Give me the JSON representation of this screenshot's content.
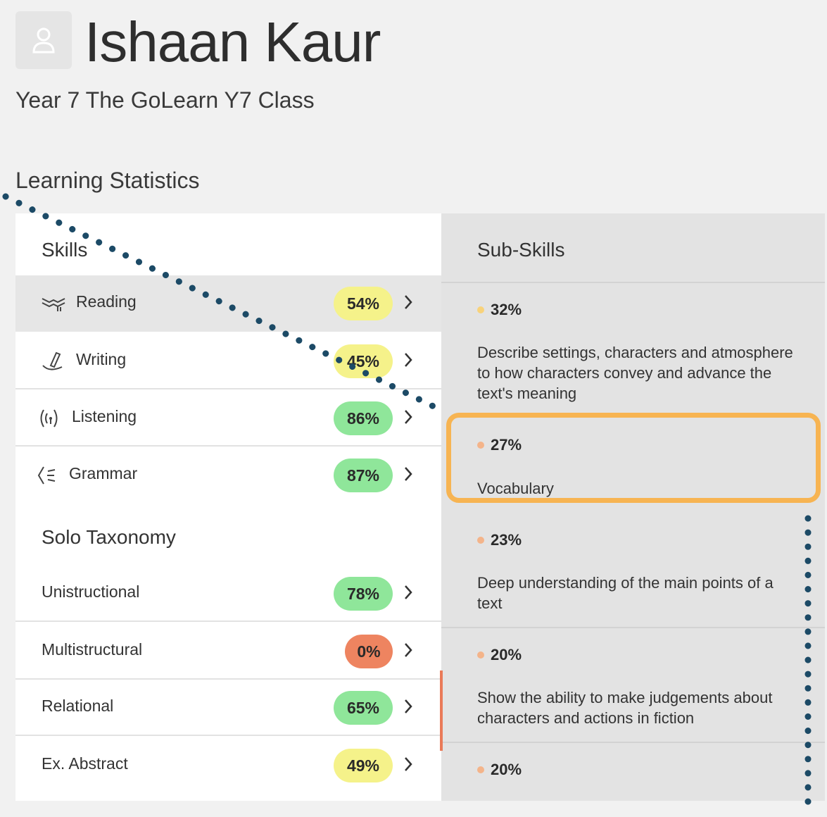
{
  "colors": {
    "badge_yellow": "#f5f28a",
    "badge_green": "#8fe69a",
    "badge_red": "#ee8460",
    "dot_yellow": "#f8d27a",
    "dot_orange": "#f4b48a",
    "highlight": "#f7b452",
    "annotation_dotted": "#1c4a66"
  },
  "student": {
    "avatar_icon": "user-icon",
    "name": "Ishaan Kaur",
    "class": "Year 7 The GoLearn Y7 Class"
  },
  "section_title": "Learning Statistics",
  "skills": {
    "heading": "Skills",
    "items": [
      {
        "label": "Reading",
        "percent": "54%",
        "icon": "reading-icon",
        "color": "yellow"
      },
      {
        "label": "Writing",
        "percent": "45%",
        "icon": "writing-icon",
        "color": "yellow"
      },
      {
        "label": "Listening",
        "percent": "86%",
        "icon": "listening-icon",
        "color": "green"
      },
      {
        "label": "Grammar",
        "percent": "87%",
        "icon": "grammar-icon",
        "color": "green"
      }
    ]
  },
  "solo": {
    "heading": "Solo Taxonomy",
    "items": [
      {
        "label": "Unistructional",
        "percent": "78%",
        "color": "green"
      },
      {
        "label": "Multistructural",
        "percent": "0%",
        "color": "red"
      },
      {
        "label": "Relational",
        "percent": "65%",
        "color": "green"
      },
      {
        "label": "Ex. Abstract",
        "percent": "49%",
        "color": "yellow"
      }
    ]
  },
  "subskills": {
    "heading": "Sub-Skills",
    "items": [
      {
        "percent": "32%",
        "description": "Describe settings, characters and atmosphere to how characters convey and advance the text's meaning",
        "dot": "yellow"
      },
      {
        "percent": "27%",
        "description": "Vocabulary",
        "dot": "orange"
      },
      {
        "percent": "23%",
        "description": "Deep understanding of the main points of a text",
        "dot": "orange"
      },
      {
        "percent": "20%",
        "description": "Show the ability to make judgements about characters and actions in fiction",
        "dot": "orange"
      },
      {
        "percent": "20%",
        "description": "",
        "dot": "orange"
      }
    ]
  }
}
